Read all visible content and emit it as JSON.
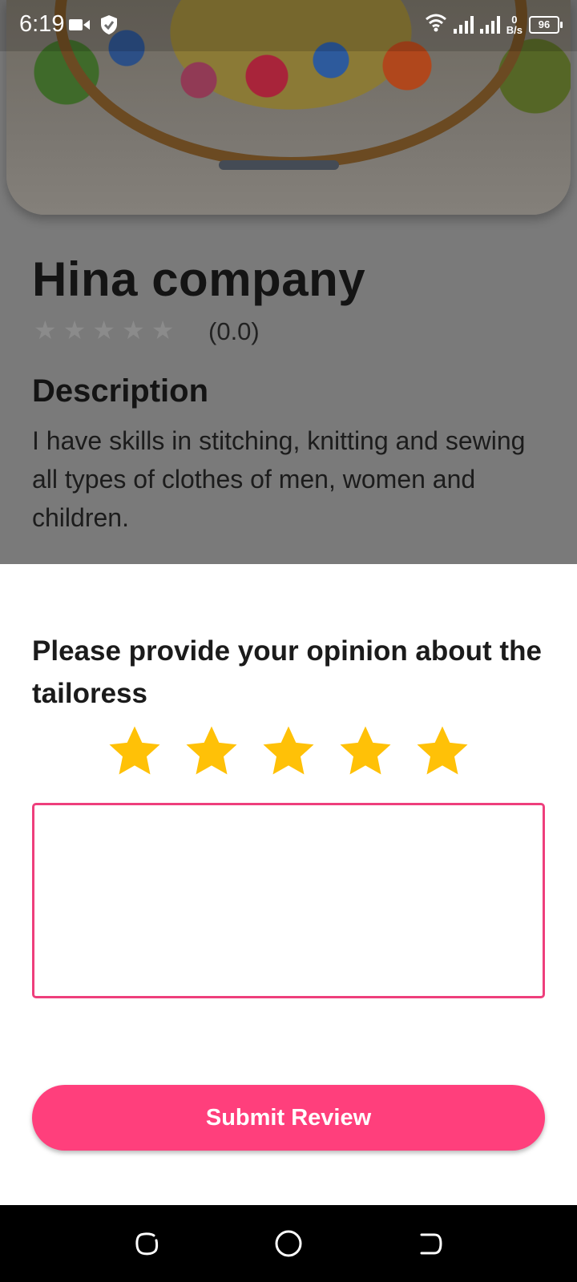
{
  "status_bar": {
    "time": "6:19",
    "icons_left": [
      "video-camera-icon",
      "shield-check-icon"
    ],
    "icons_right": [
      "wifi-icon",
      "signal-icon",
      "signal-icon",
      "net-speed",
      "battery-icon"
    ],
    "net_speed_value": "0",
    "net_speed_unit": "B/s",
    "battery_level": "96"
  },
  "profile": {
    "name": "Hina company",
    "rating_text": "(0.0)",
    "rating_stars_filled": 0,
    "rating_stars_total": 5,
    "description_heading": "Description",
    "description": "I have skills in stitching, knitting and sewing all types of clothes of men, women and children."
  },
  "review_sheet": {
    "prompt": "Please provide your opinion about the tailoress",
    "stars_selected": 5,
    "stars_total": 5,
    "star_color": "#FFC107",
    "review_value": "",
    "submit_label": "Submit Review",
    "accent_color": "#FF3F7C"
  },
  "nav_bar": {
    "buttons": [
      "recent-apps-icon",
      "home-icon",
      "back-icon"
    ]
  }
}
